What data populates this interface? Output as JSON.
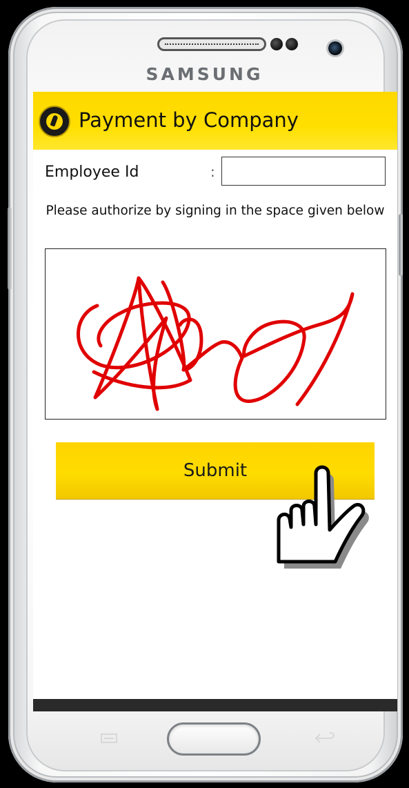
{
  "device": {
    "brand": "SAMSUNG"
  },
  "app_bar": {
    "title": "Payment by Company",
    "logo_icon": "company-logo-icon",
    "background": "#ffd800"
  },
  "form": {
    "employee_id_label": "Employee Id",
    "employee_id_separator": ":",
    "employee_id_value": "",
    "instruction": "Please authorize by signing in the space given below",
    "signature_stroke_color": "#e00000"
  },
  "actions": {
    "submit_label": "Submit",
    "submit_color": "#ffd800"
  },
  "overlay": {
    "pointer_icon": "hand-pointer-icon"
  }
}
